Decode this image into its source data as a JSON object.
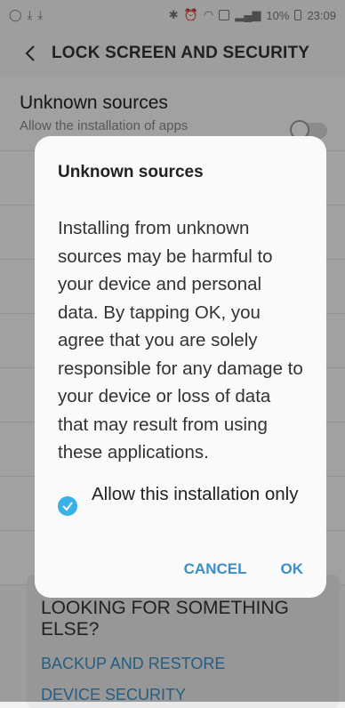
{
  "statusbar": {
    "battery": "10%",
    "time": "23:09"
  },
  "header": {
    "title": "LOCK SCREEN AND SECURITY"
  },
  "settings": {
    "unknown_title": "Unknown sources",
    "unknown_sub": "Allow the installation of apps"
  },
  "looking": {
    "title": "LOOKING FOR SOMETHING ELSE?",
    "link1": "BACKUP AND RESTORE",
    "link2": "DEVICE SECURITY"
  },
  "dialog": {
    "title": "Unknown sources",
    "body": "Installing from unknown sources may be harmful to your device and personal data. By tapping OK, you agree that you are solely responsible for any damage to your device or loss of data that may result from using these applications.",
    "checkbox_label": "Allow this installation only",
    "cancel": "CANCEL",
    "ok": "OK"
  },
  "colors": {
    "accent": "#3a8fc7",
    "check": "#3ab0e8"
  }
}
